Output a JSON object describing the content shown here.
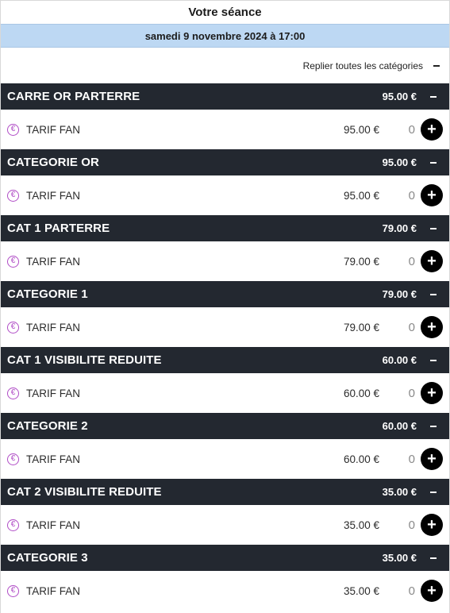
{
  "header": {
    "title": "Votre séance",
    "date": "samedi 9 novembre 2024 à 17:00"
  },
  "collapse_all_label": "Replier toutes les catégories",
  "colors": {
    "header_bg": "#232830",
    "date_bar_bg": "#bdd8f3",
    "euro_icon": "#b04cc6",
    "add_button": "#000000"
  },
  "icons": {
    "euro": "€",
    "plus": "+",
    "collapse": "minus-icon"
  },
  "categories": [
    {
      "name": "CARRE OR PARTERRE",
      "price": "95.00 €",
      "tarif": {
        "name": "TARIF FAN",
        "price": "95.00 €",
        "qty": "0"
      }
    },
    {
      "name": "CATEGORIE OR",
      "price": "95.00 €",
      "tarif": {
        "name": "TARIF FAN",
        "price": "95.00 €",
        "qty": "0"
      }
    },
    {
      "name": "CAT 1 PARTERRE",
      "price": "79.00 €",
      "tarif": {
        "name": "TARIF FAN",
        "price": "79.00 €",
        "qty": "0"
      }
    },
    {
      "name": "CATEGORIE 1",
      "price": "79.00 €",
      "tarif": {
        "name": "TARIF FAN",
        "price": "79.00 €",
        "qty": "0"
      }
    },
    {
      "name": "CAT 1 VISIBILITE REDUITE",
      "price": "60.00 €",
      "tarif": {
        "name": "TARIF FAN",
        "price": "60.00 €",
        "qty": "0"
      }
    },
    {
      "name": "CATEGORIE 2",
      "price": "60.00 €",
      "tarif": {
        "name": "TARIF FAN",
        "price": "60.00 €",
        "qty": "0"
      }
    },
    {
      "name": "CAT 2 VISIBILITE REDUITE",
      "price": "35.00 €",
      "tarif": {
        "name": "TARIF FAN",
        "price": "35.00 €",
        "qty": "0"
      }
    },
    {
      "name": "CATEGORIE 3",
      "price": "35.00 €",
      "tarif": {
        "name": "TARIF FAN",
        "price": "35.00 €",
        "qty": "0"
      }
    }
  ]
}
